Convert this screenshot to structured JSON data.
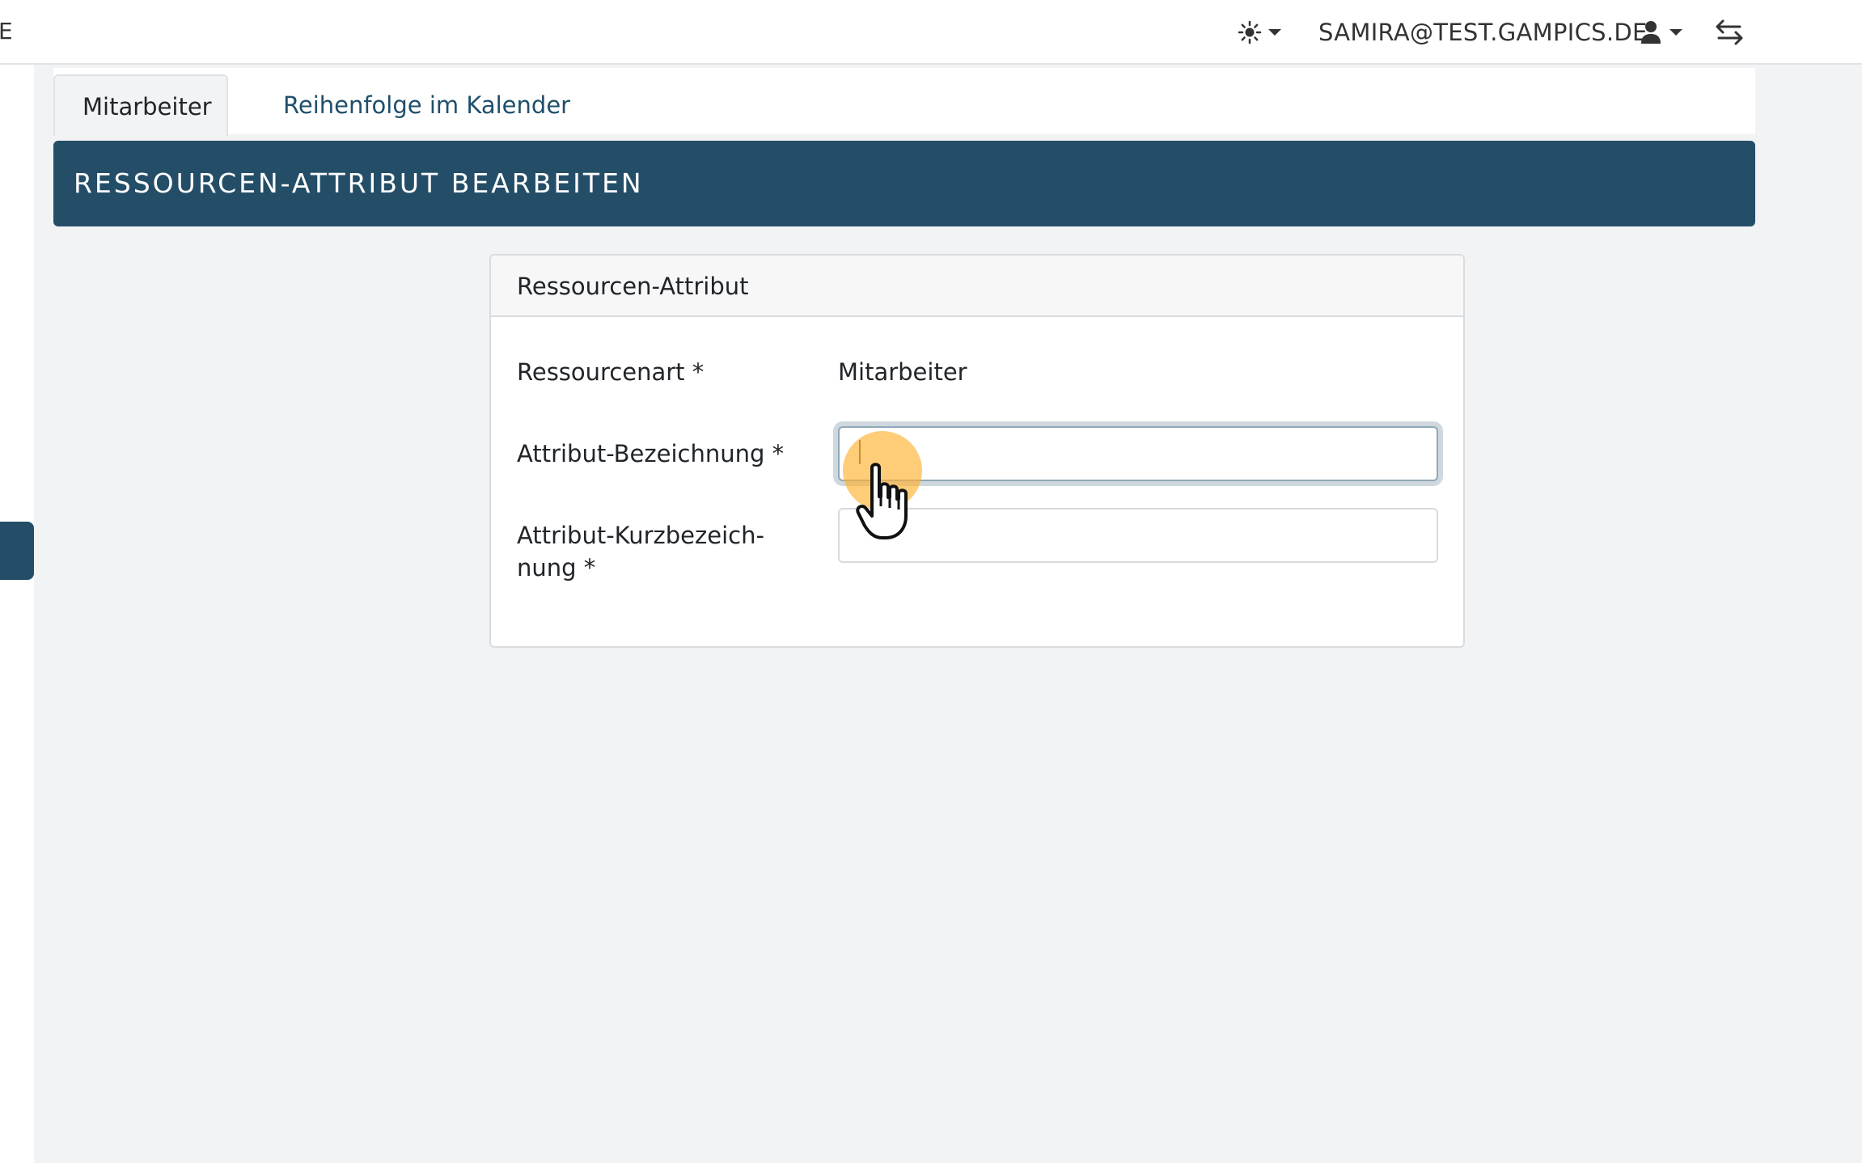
{
  "topbar": {
    "edge_letter": "E",
    "theme_icon": "sun-icon",
    "user_email": "SAMIRA@TEST.GAMPICS.DE",
    "user_icon": "user-icon",
    "switch_icon": "switch-arrows-icon"
  },
  "tabs": [
    {
      "label": "Mitarbeiter",
      "active": true
    },
    {
      "label": "Reihenfolge im Kalender",
      "active": false
    }
  ],
  "page": {
    "title": "RESSOURCEN-ATTRIBUT BEARBEITEN"
  },
  "card": {
    "title": "Ressourcen-Attribut",
    "fields": {
      "resource_type_label": "Ressourcenart *",
      "resource_type_value": "Mitarbeiter",
      "attribute_name_label": "Attribut-Bezeichnung *",
      "attribute_name_value": "",
      "attribute_short_label_line1": "Attribut-Kurzbezeich-",
      "attribute_short_label_line2": "nung *",
      "attribute_short_value": ""
    }
  },
  "colors": {
    "primary": "#244e68",
    "link": "#1f4f6b",
    "background": "#f2f3f5",
    "click_highlight": "#ffb030"
  }
}
